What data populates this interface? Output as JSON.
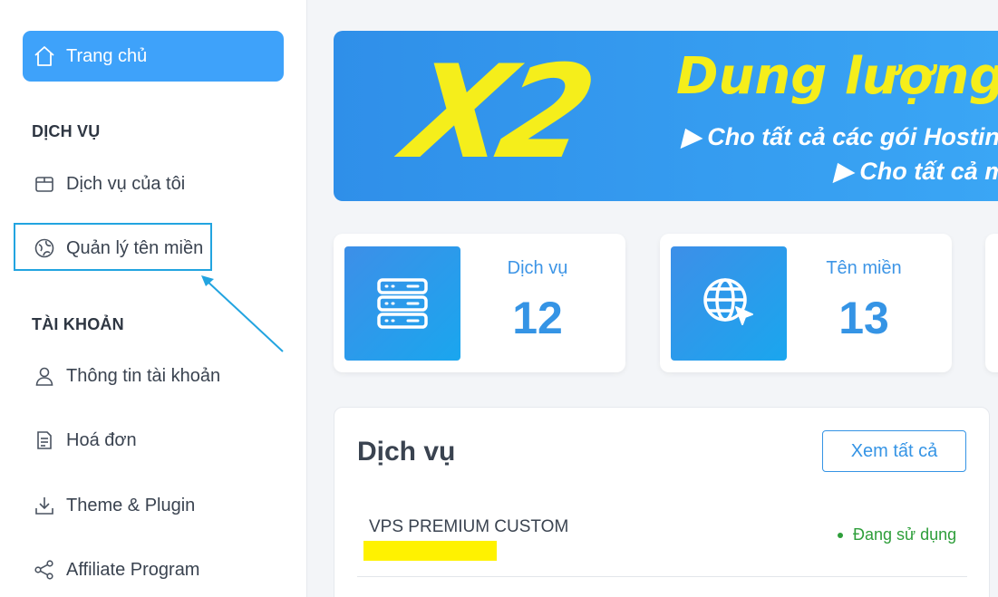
{
  "sidebar": {
    "home_label": "Trang chủ",
    "section_services": "DỊCH VỤ",
    "my_services": "Dịch vụ của tôi",
    "domain_manage": "Quản lý tên miền",
    "section_account": "TÀI KHOẢN",
    "account_info": "Thông tin tài khoản",
    "invoices": "Hoá đơn",
    "theme_plugin": "Theme & Plugin",
    "affiliate": "Affiliate Program"
  },
  "banner": {
    "big": "X2",
    "title": "Dung lượng",
    "line1": "▶ Cho tất cả các gói Hosting",
    "line2": "▶ Cho tất cả m"
  },
  "stats": [
    {
      "label": "Dịch vụ",
      "value": "12",
      "icon": "server-icon"
    },
    {
      "label": "Tên miền",
      "value": "13",
      "icon": "globe-cursor-icon"
    }
  ],
  "services": {
    "heading": "Dịch vụ",
    "see_all": "Xem tất cả",
    "items": [
      {
        "name": "VPS PREMIUM CUSTOM",
        "status": "Đang sử dụng"
      }
    ]
  },
  "colors": {
    "accent": "#3ea2fa",
    "highlight": "#22a4e0",
    "status_active": "#2e9e3a",
    "banner_yellow": "#f5ee1b"
  }
}
